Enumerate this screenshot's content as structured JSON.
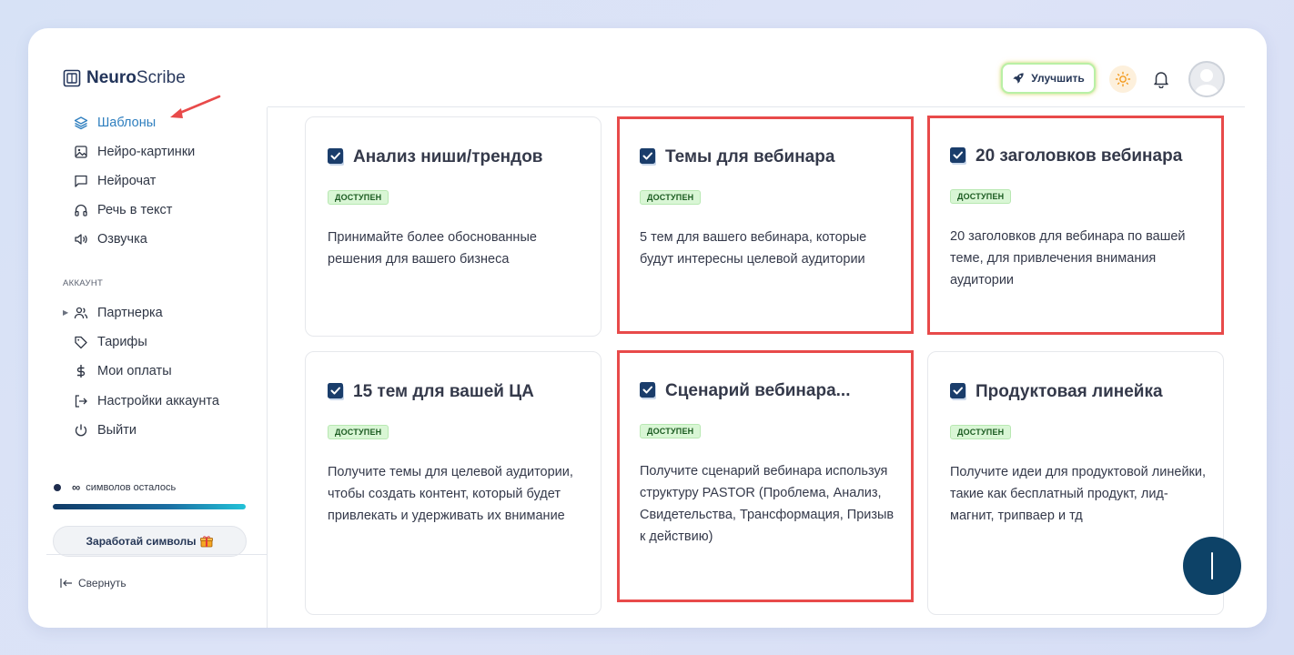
{
  "brand": {
    "bold": "Neuro",
    "light": "Scribe"
  },
  "header": {
    "upgrade_label": "Улучшить"
  },
  "sidebar": {
    "items": [
      {
        "label": "Шаблоны",
        "icon": "layers-icon",
        "active": true
      },
      {
        "label": "Нейро-картинки",
        "icon": "image-icon"
      },
      {
        "label": "Нейрочат",
        "icon": "chat-icon"
      },
      {
        "label": "Речь в текст",
        "icon": "headphones-icon"
      },
      {
        "label": "Озвучка",
        "icon": "speaker-icon"
      }
    ],
    "account_label": "АККАУНТ",
    "account_items": [
      {
        "label": "Партнерка",
        "icon": "users-icon"
      },
      {
        "label": "Тарифы",
        "icon": "tag-icon"
      },
      {
        "label": "Мои оплаты",
        "icon": "dollar-icon"
      },
      {
        "label": "Настройки аккаунта",
        "icon": "login-icon"
      },
      {
        "label": "Выйти",
        "icon": "power-icon"
      }
    ],
    "symbols_value": "∞",
    "symbols_text": "символов осталось",
    "symbols_progress": 1.0,
    "earn_label": "Заработай символы",
    "collapse_label": "Свернуть"
  },
  "cards": [
    {
      "title": "Анализ ниши/трендов",
      "badge": "доступен",
      "desc": "Принимайте более обоснованные решения для вашего бизнеса",
      "highlighted": false
    },
    {
      "title": "Темы для вебинара",
      "badge": "доступен",
      "desc": "5 тем для вашего вебинара, которые будут интересны целевой аудитории",
      "highlighted": true
    },
    {
      "title": "20 заголовков вебинара",
      "badge": "доступен",
      "desc": "20 заголовков для вебинара по вашей теме, для привлечения внимания аудитории",
      "highlighted": true
    },
    {
      "title": "15 тем для вашей ЦА",
      "badge": "доступен",
      "desc": "Получите темы для целевой аудитории, чтобы создать контент, который будет привлекать и удерживать их внимание",
      "highlighted": false
    },
    {
      "title": "Сценарий вебинара...",
      "badge": "доступен",
      "desc": "Получите сценарий вебинара используя структуру PASTOR (Проблема, Анализ, Свидетельства, Трансформация, Призыв к действию)",
      "highlighted": true
    },
    {
      "title": "Продуктовая линейка",
      "badge": "доступен",
      "desc": "Получите идеи для продуктовой линейки, такие как бесплатный продукт, лид-магнит, трипваер и тд",
      "highlighted": false
    }
  ],
  "colors": {
    "accent": "#2f7fbf",
    "highlight": "#e84a4a",
    "badge_bg": "#d9f6d5",
    "fab": "#0d4267"
  }
}
